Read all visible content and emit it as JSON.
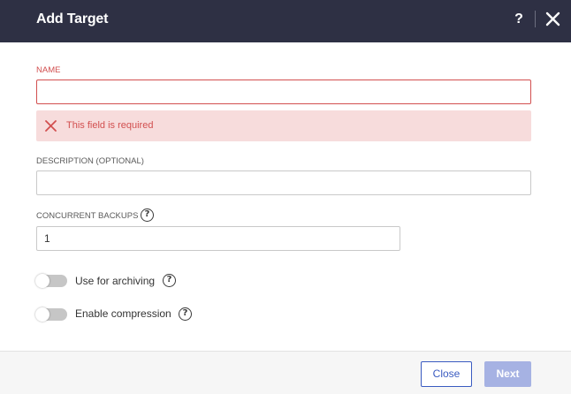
{
  "dialog": {
    "title": "Add Target",
    "help_label": "?"
  },
  "form": {
    "name": {
      "label": "NAME",
      "value": "",
      "error": "This field is required"
    },
    "description": {
      "label": "DESCRIPTION (OPTIONAL)",
      "value": ""
    },
    "concurrent_backups": {
      "label": "CONCURRENT BACKUPS",
      "value": "1"
    },
    "archiving": {
      "label": "Use for archiving",
      "enabled": false
    },
    "compression": {
      "label": "Enable compression",
      "enabled": false
    }
  },
  "footer": {
    "close_label": "Close",
    "next_label": "Next"
  },
  "colors": {
    "header_bg": "#2e3044",
    "error": "#d24f4f",
    "error_bg": "#f7dcdc",
    "primary": "#3a5bc1",
    "primary_disabled": "#a6b2e3"
  }
}
